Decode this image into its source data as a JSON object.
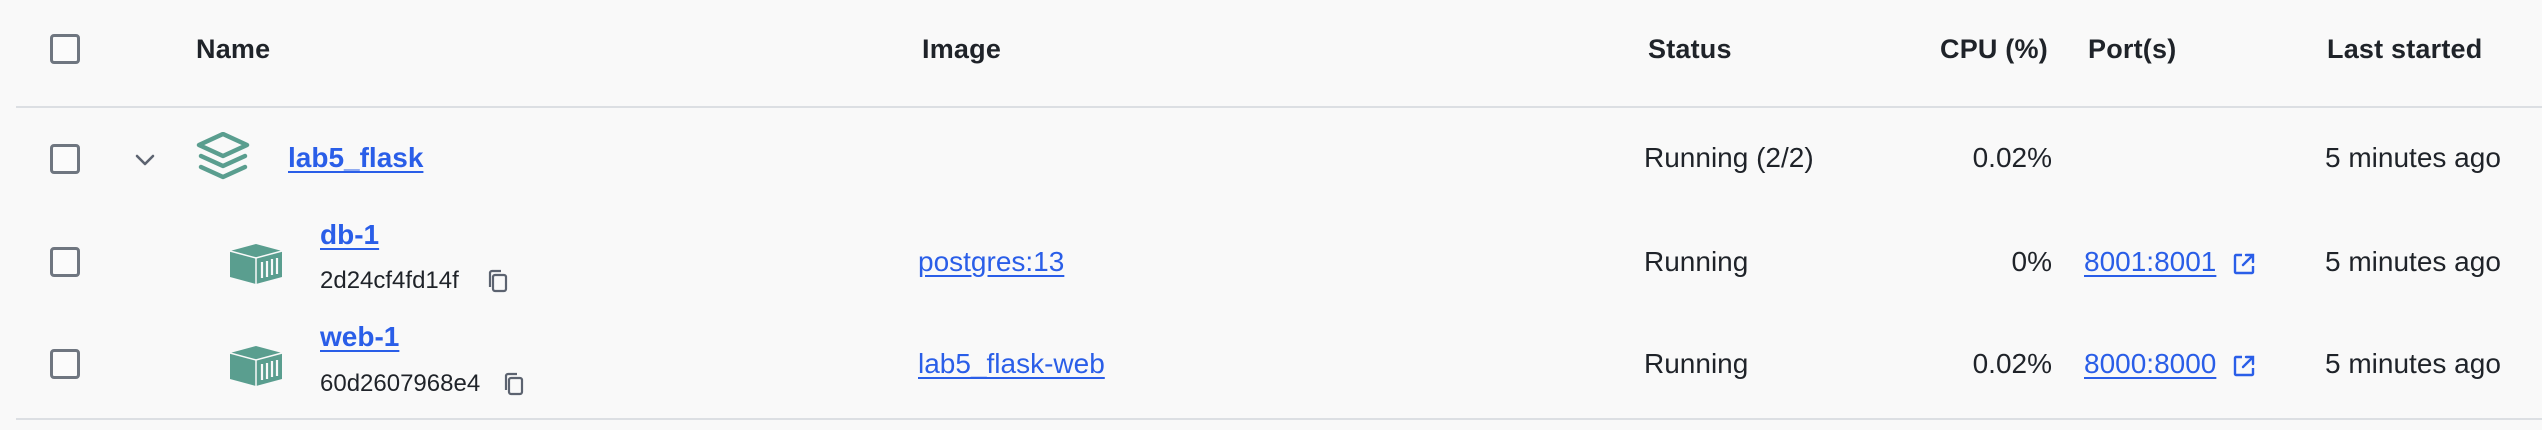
{
  "header": {
    "name": "Name",
    "image": "Image",
    "status": "Status",
    "cpu": "CPU (%)",
    "ports": "Port(s)",
    "last_started": "Last started"
  },
  "rows": [
    {
      "name": "lab5_flask",
      "image": "",
      "status": "Running (2/2)",
      "cpu": "0.02%",
      "ports": "",
      "last_started": "5 minutes ago",
      "icon": "stack-layers-icon"
    },
    {
      "name": "db-1",
      "id": "2d24cf4fd14f",
      "image": "postgres:13",
      "status": "Running",
      "cpu": "0%",
      "ports": "8001:8001",
      "last_started": "5 minutes ago",
      "icon": "container-cube-icon"
    },
    {
      "name": "web-1",
      "id": "60d2607968e4",
      "image": "lab5_flask-web",
      "status": "Running",
      "cpu": "0.02%",
      "ports": "8000:8000",
      "last_started": "5 minutes ago",
      "icon": "container-cube-icon"
    }
  ],
  "colors": {
    "accent_link": "#2a5ee8",
    "icon_green": "#5a9e8f",
    "divider": "#dcdfe3",
    "checkbox_border": "#6f7680"
  }
}
